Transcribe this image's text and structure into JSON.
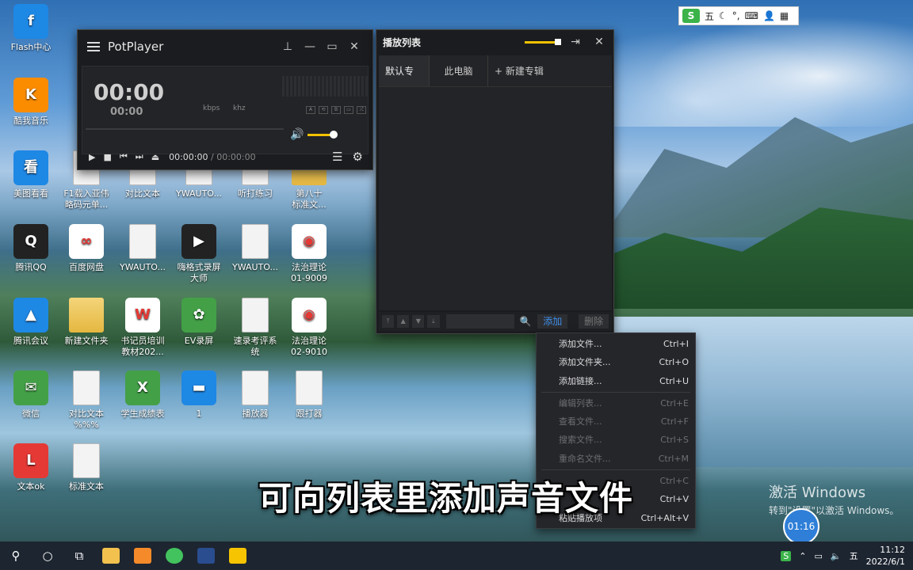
{
  "desktop": {
    "icons": [
      {
        "label": "Flash中心",
        "glyph": "f"
      },
      {
        "label": "酷我音乐",
        "glyph": "K"
      },
      {
        "label": "美图看看",
        "glyph": "看"
      },
      {
        "label": "腾讯QQ",
        "glyph": "Q"
      },
      {
        "label": "腾讯会议",
        "glyph": "▲"
      },
      {
        "label": "微信",
        "glyph": "✉"
      },
      {
        "label": "文本ok",
        "glyph": "L"
      },
      {
        "label": "F1载入亚伟\n略码元单...",
        "glyph": ""
      },
      {
        "label": "百度网盘",
        "glyph": "∞"
      },
      {
        "label": "新建文件夹",
        "glyph": ""
      },
      {
        "label": "对比文本\n%%%",
        "glyph": ""
      },
      {
        "label": "标准文本",
        "glyph": ""
      },
      {
        "label": "对比文本",
        "glyph": ""
      },
      {
        "label": "YWAUTO...",
        "glyph": ""
      },
      {
        "label": "书记员培训\n教材202...",
        "glyph": "W"
      },
      {
        "label": "学生成绩表",
        "glyph": "X"
      },
      {
        "label": "YWAUTO...",
        "glyph": ""
      },
      {
        "label": "嗨格式录屏\n大师",
        "glyph": "▶"
      },
      {
        "label": "EV录屏",
        "glyph": "✿"
      },
      {
        "label": "1",
        "glyph": "▬"
      },
      {
        "label": "听打练习",
        "glyph": ""
      },
      {
        "label": "YWAUTO...",
        "glyph": ""
      },
      {
        "label": "速录考评系\n统",
        "glyph": ""
      },
      {
        "label": "播放器",
        "glyph": ""
      },
      {
        "label": "第八十\n标准文...",
        "glyph": ""
      },
      {
        "label": "法治理论\n01-9009",
        "glyph": "◉"
      },
      {
        "label": "法治理论\n02-9010",
        "glyph": "◉"
      },
      {
        "label": "跟打器",
        "glyph": ""
      }
    ]
  },
  "potplayer": {
    "title": "PotPlayer",
    "time_main": "00:00",
    "time_sub": "00:00",
    "kbps": "kbps",
    "khz": "khz",
    "position": "00:00:00",
    "separator": "/",
    "duration": "00:00:00",
    "mini_buttons": [
      "A",
      "⟲",
      "B",
      "▭",
      "⤮"
    ]
  },
  "playlist": {
    "title": "播放列表",
    "tabs": [
      "默认专辑",
      "此电脑",
      "+ 新建专辑"
    ],
    "add_label": "添加",
    "delete_label": "删除"
  },
  "context_menu": {
    "groups": [
      [
        {
          "label": "添加文件...",
          "shortcut": "Ctrl+I",
          "enabled": true
        },
        {
          "label": "添加文件夹...",
          "shortcut": "Ctrl+O",
          "enabled": true
        },
        {
          "label": "添加链接...",
          "shortcut": "Ctrl+U",
          "enabled": true
        }
      ],
      [
        {
          "label": "编辑列表...",
          "shortcut": "Ctrl+E",
          "enabled": false
        },
        {
          "label": "查看文件...",
          "shortcut": "Ctrl+F",
          "enabled": false
        },
        {
          "label": "搜索文件...",
          "shortcut": "Ctrl+S",
          "enabled": false
        },
        {
          "label": "重命名文件...",
          "shortcut": "Ctrl+M",
          "enabled": false
        }
      ],
      [
        {
          "label": "",
          "shortcut": "Ctrl+C",
          "enabled": false
        },
        {
          "label": "",
          "shortcut": "Ctrl+V",
          "enabled": true
        },
        {
          "label": "粘贴播放项",
          "shortcut": "Ctrl+Alt+V",
          "enabled": true
        }
      ]
    ]
  },
  "subtitle": "可向列表里添加声音文件",
  "ime": {
    "logo": "S",
    "mode": "五"
  },
  "watermark": {
    "line1": "激活 Windows",
    "line2": "转到\"设置\"以激活 Windows。"
  },
  "clock_bubble": "01:16",
  "taskbar": {
    "time": "11:12",
    "date": "2022/6/1"
  }
}
